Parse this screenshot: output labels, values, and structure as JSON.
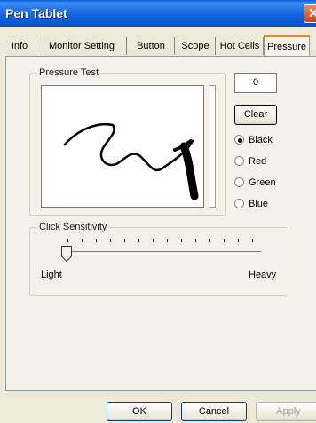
{
  "window": {
    "title": "Pen Tablet",
    "close_glyph": "✕"
  },
  "tabs": [
    {
      "label": "Info"
    },
    {
      "label": "Monitor Setting"
    },
    {
      "label": "Button"
    },
    {
      "label": "Scope"
    },
    {
      "label": "Hot Cells"
    },
    {
      "label": "Pressure",
      "active": true
    }
  ],
  "pressure_test": {
    "group_label": "Pressure Test",
    "value": "0",
    "clear_label": "Clear",
    "colors": [
      {
        "label": "Black",
        "selected": true
      },
      {
        "label": "Red",
        "selected": false
      },
      {
        "label": "Green",
        "selected": false
      },
      {
        "label": "Blue",
        "selected": false
      }
    ]
  },
  "click_sensitivity": {
    "group_label": "Click Sensitivity",
    "min_label": "Light",
    "max_label": "Heavy",
    "level": 0.05
  },
  "footer": {
    "ok_label": "OK",
    "cancel_label": "Cancel",
    "apply_label": "Apply"
  }
}
